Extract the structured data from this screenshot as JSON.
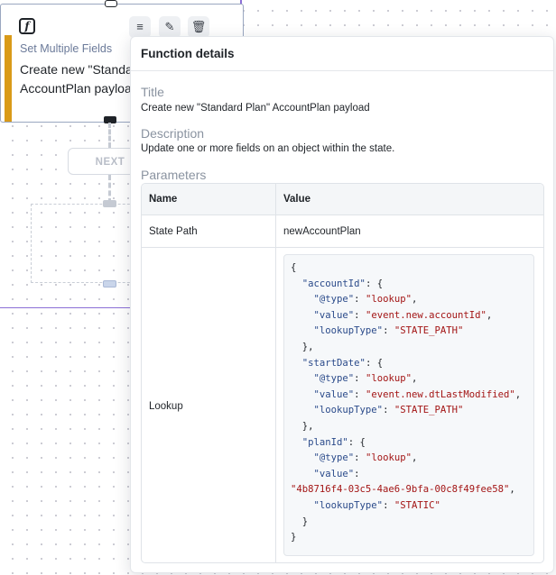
{
  "node": {
    "icon": "function-icon",
    "icon_glyph": "f",
    "subtitle": "Set Multiple Fields",
    "title_line1": "Create new \"Standa",
    "title_line2": "AccountPlan payloa",
    "toolbar": [
      {
        "name": "settings-list-icon",
        "glyph": "≡"
      },
      {
        "name": "edit-pencil-icon",
        "glyph": "✎"
      },
      {
        "name": "delete-trash-icon",
        "glyph": "🗑"
      }
    ]
  },
  "next_button": {
    "label": "NEXT"
  },
  "popover": {
    "header": "Function details",
    "title_label": "Title",
    "title_value": "Create new \"Standard Plan\" AccountPlan payload",
    "description_label": "Description",
    "description_value": "Update one or more fields on an object within the state.",
    "parameters_label": "Parameters",
    "table": {
      "columns": [
        "Name",
        "Value"
      ],
      "rows": [
        {
          "name": "State Path",
          "value": "newAccountPlan"
        },
        {
          "name": "Lookup",
          "value_code": [
            [
              [
                "p",
                "{"
              ]
            ],
            [
              [
                "p",
                "  "
              ],
              [
                "k",
                "\"accountId\""
              ],
              [
                "p",
                ": {"
              ]
            ],
            [
              [
                "p",
                "    "
              ],
              [
                "k",
                "\"@type\""
              ],
              [
                "p",
                ": "
              ],
              [
                "s",
                "\"lookup\""
              ],
              [
                "p",
                ","
              ]
            ],
            [
              [
                "p",
                "    "
              ],
              [
                "k",
                "\"value\""
              ],
              [
                "p",
                ": "
              ],
              [
                "s",
                "\"event.new.accountId\""
              ],
              [
                "p",
                ","
              ]
            ],
            [
              [
                "p",
                "    "
              ],
              [
                "k",
                "\"lookupType\""
              ],
              [
                "p",
                ": "
              ],
              [
                "s",
                "\"STATE_PATH\""
              ]
            ],
            [
              [
                "p",
                "  },"
              ]
            ],
            [
              [
                "p",
                "  "
              ],
              [
                "k",
                "\"startDate\""
              ],
              [
                "p",
                ": {"
              ]
            ],
            [
              [
                "p",
                "    "
              ],
              [
                "k",
                "\"@type\""
              ],
              [
                "p",
                ": "
              ],
              [
                "s",
                "\"lookup\""
              ],
              [
                "p",
                ","
              ]
            ],
            [
              [
                "p",
                "    "
              ],
              [
                "k",
                "\"value\""
              ],
              [
                "p",
                ": "
              ],
              [
                "s",
                "\"event.new.dtLastModified\""
              ],
              [
                "p",
                ","
              ]
            ],
            [
              [
                "p",
                "    "
              ],
              [
                "k",
                "\"lookupType\""
              ],
              [
                "p",
                ": "
              ],
              [
                "s",
                "\"STATE_PATH\""
              ]
            ],
            [
              [
                "p",
                "  },"
              ]
            ],
            [
              [
                "p",
                "  "
              ],
              [
                "k",
                "\"planId\""
              ],
              [
                "p",
                ": {"
              ]
            ],
            [
              [
                "p",
                "    "
              ],
              [
                "k",
                "\"@type\""
              ],
              [
                "p",
                ": "
              ],
              [
                "s",
                "\"lookup\""
              ],
              [
                "p",
                ","
              ]
            ],
            [
              [
                "p",
                "    "
              ],
              [
                "k",
                "\"value\""
              ],
              [
                "p",
                ":"
              ]
            ],
            [
              [
                "s",
                "\"4b8716f4-03c5-4ae6-9bfa-00c8f49fee58\""
              ],
              [
                "p",
                ","
              ]
            ],
            [
              [
                "p",
                "    "
              ],
              [
                "k",
                "\"lookupType\""
              ],
              [
                "p",
                ": "
              ],
              [
                "s",
                "\"STATIC\""
              ]
            ],
            [
              [
                "p",
                "  }"
              ]
            ],
            [
              [
                "p",
                "}"
              ]
            ]
          ]
        }
      ]
    }
  },
  "colors": {
    "accent": "#d99a18",
    "connector": "#8b6fd6",
    "json_key": "#2a4a8a",
    "json_string": "#a31515"
  }
}
